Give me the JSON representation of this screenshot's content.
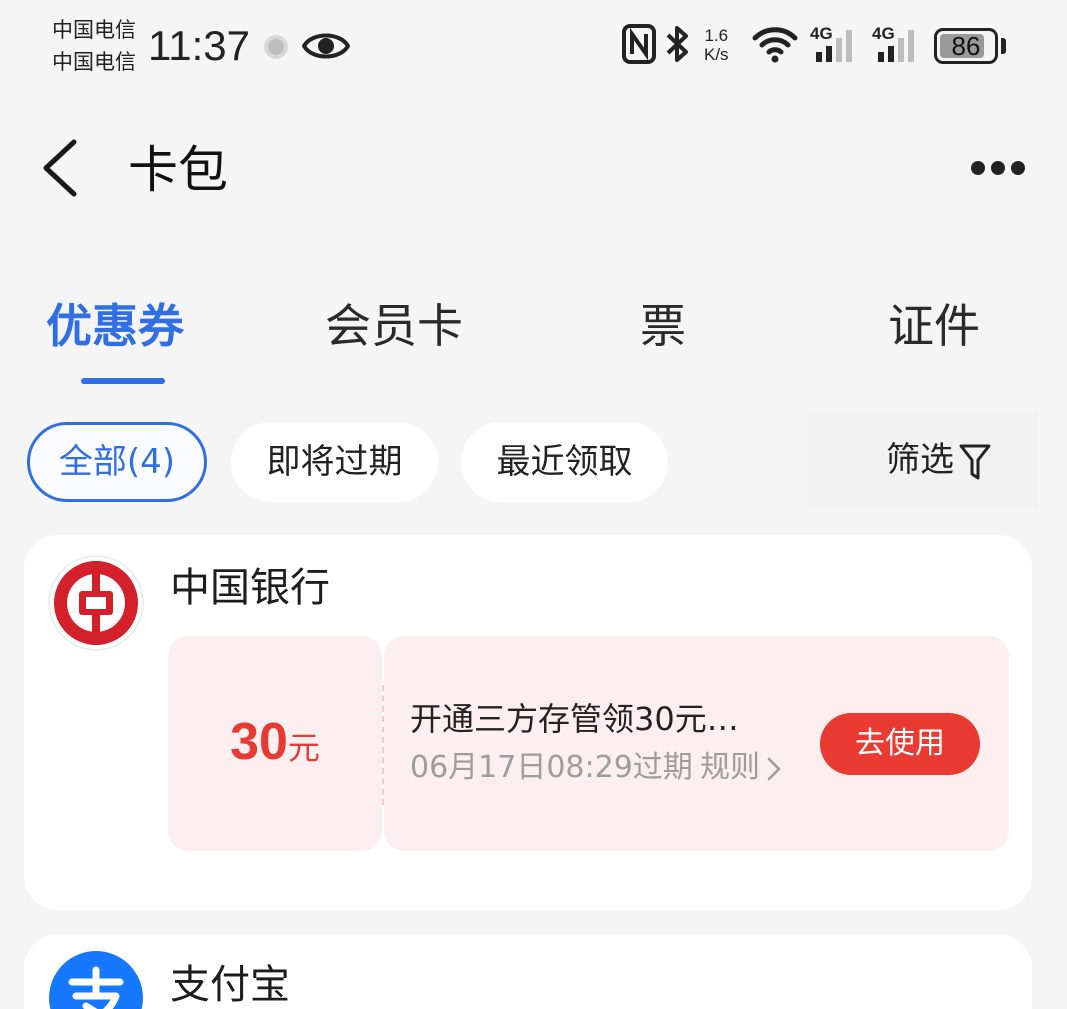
{
  "status_bar": {
    "carrier_1": "中国电信",
    "carrier_2": "中国电信",
    "time": "11:37",
    "net_speed_value": "1.6",
    "net_speed_unit": "K/s",
    "sim1_type": "4G",
    "sim2_type": "4G",
    "battery_percent": "86",
    "battery_level": 0.86
  },
  "header": {
    "title": "卡包"
  },
  "tabs": [
    {
      "label": "优惠券",
      "active": true
    },
    {
      "label": "会员卡",
      "active": false
    },
    {
      "label": "票",
      "active": false
    },
    {
      "label": "证件",
      "active": false
    }
  ],
  "filters": {
    "chips": [
      {
        "label": "全部(4)",
        "active": true
      },
      {
        "label": "即将过期",
        "active": false
      },
      {
        "label": "最近领取",
        "active": false
      }
    ],
    "filter_label": "筛选"
  },
  "merchants": [
    {
      "name": "中国银行",
      "logo_icon": "bank-of-china-logo",
      "logo_color": "#d4202b",
      "coupon": {
        "amount": "30",
        "unit": "元",
        "title": "开通三方存管领30元…",
        "expiry": "06月17日08:29过期",
        "rules_label": "规则",
        "action_label": "去使用"
      }
    },
    {
      "name": "支付宝",
      "logo_icon": "alipay-logo",
      "logo_color": "#1677ff"
    }
  ],
  "colors": {
    "accent": "#2f6ee3",
    "coupon_red": "#e83a35",
    "coupon_bg": "#fdeeef"
  }
}
